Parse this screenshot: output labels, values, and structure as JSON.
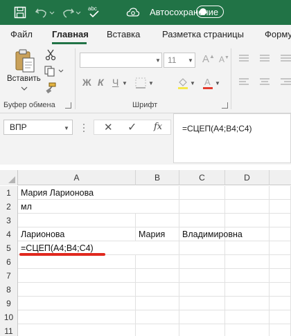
{
  "titlebar": {
    "autosave_label": "Автосохранение",
    "autosave_state": "off",
    "accent_color": "#217346"
  },
  "ribbon_tabs": [
    {
      "label": "Файл",
      "active": false
    },
    {
      "label": "Главная",
      "active": true
    },
    {
      "label": "Вставка",
      "active": false
    },
    {
      "label": "Разметка страницы",
      "active": false
    },
    {
      "label": "Форму",
      "active": false
    }
  ],
  "clipboard_group": {
    "paste_label": "Вставить",
    "group_label": "Буфер обмена"
  },
  "font_group": {
    "font_name": "",
    "font_size": "11",
    "bold_label": "Ж",
    "italic_label": "К",
    "underline_label": "Ч",
    "group_label": "Шрифт"
  },
  "formula_bar": {
    "name_box": "ВПР",
    "cancel_symbol": "✕",
    "enter_symbol": "✓",
    "fx_label": "fx",
    "formula": "=СЦЕП(A4;B4;C4)"
  },
  "grid": {
    "columns": [
      "A",
      "B",
      "C",
      "D"
    ],
    "rows": [
      {
        "num": "1",
        "A": "Мария Ларионова",
        "B": "",
        "C": "",
        "D": ""
      },
      {
        "num": "2",
        "A": "мл",
        "B": "",
        "C": "",
        "D": ""
      },
      {
        "num": "3",
        "A": "",
        "B": "",
        "C": "",
        "D": ""
      },
      {
        "num": "4",
        "A": "Ларионова",
        "B": "Мария",
        "C": "Владимировна",
        "D": ""
      },
      {
        "num": "5",
        "A": "=СЦЕП(A4;B4;C4)",
        "B": "",
        "C": "",
        "D": ""
      },
      {
        "num": "6",
        "A": "",
        "B": "",
        "C": "",
        "D": ""
      },
      {
        "num": "7",
        "A": "",
        "B": "",
        "C": "",
        "D": ""
      },
      {
        "num": "8",
        "A": "",
        "B": "",
        "C": "",
        "D": ""
      },
      {
        "num": "9",
        "A": "",
        "B": "",
        "C": "",
        "D": ""
      },
      {
        "num": "10",
        "A": "",
        "B": "",
        "C": "",
        "D": ""
      },
      {
        "num": "11",
        "A": "",
        "B": "",
        "C": "",
        "D": ""
      }
    ],
    "annotation_color": "#e0281e"
  }
}
